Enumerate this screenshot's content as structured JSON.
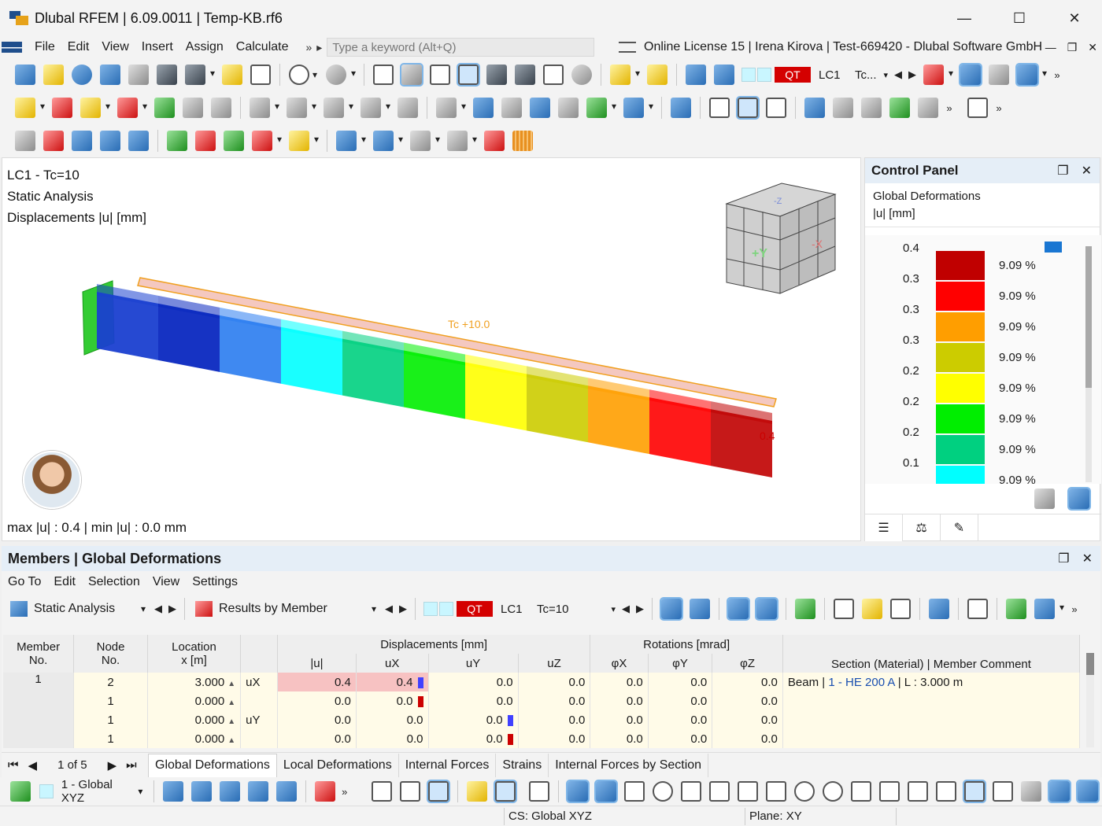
{
  "window": {
    "title": "Dlubal RFEM | 6.09.0011 | Temp-KB.rf6",
    "minimize": "—",
    "maximize": "☐",
    "close": "✕"
  },
  "menu": {
    "items": [
      "File",
      "Edit",
      "View",
      "Insert",
      "Assign",
      "Calculate"
    ],
    "more": "»",
    "search_placeholder": "Type a keyword (Alt+Q)",
    "license": "Online License 15 | Irena Kirova | Test-669420 - Dlubal Software GmbH"
  },
  "toolbar": {
    "load_case_qt": "QT",
    "load_case_name": "LC1",
    "load_case_combo": "Tc..."
  },
  "viewport": {
    "line1": "LC1 - Tc=10",
    "line2": "Static Analysis",
    "line3": "Displacements |u| [mm]",
    "load_label": "Tc +10.0",
    "max_value_label": "0.4",
    "footer": "max |u| : 0.4 | min |u| : 0.0 mm",
    "cube_face_front": "+Y",
    "cube_face_side": "-X",
    "cube_face_top": "-Z"
  },
  "control_panel": {
    "title": "Control Panel",
    "subtitle": "Global Deformations",
    "unit": "|u| [mm]",
    "legend": [
      {
        "value": "0.4",
        "percent": "9.09 %",
        "color": "#c00000"
      },
      {
        "value": "0.3",
        "percent": "9.09 %",
        "color": "#ff0000"
      },
      {
        "value": "0.3",
        "percent": "9.09 %",
        "color": "#ff9e00"
      },
      {
        "value": "0.3",
        "percent": "9.09 %",
        "color": "#cccc00"
      },
      {
        "value": "0.2",
        "percent": "9.09 %",
        "color": "#ffff00"
      },
      {
        "value": "0.2",
        "percent": "9.09 %",
        "color": "#00ee00"
      },
      {
        "value": "0.2",
        "percent": "9.09 %",
        "color": "#00d080"
      },
      {
        "value": "0.1",
        "percent": "9.09 %",
        "color": "#00ffff"
      }
    ]
  },
  "results": {
    "title": "Members | Global Deformations",
    "menu": [
      "Go To",
      "Edit",
      "Selection",
      "View",
      "Settings"
    ],
    "analysis_combo": "Static Analysis",
    "results_combo": "Results by Member",
    "lc_qt": "QT",
    "lc_name": "LC1",
    "lc_desc": "Tc=10",
    "headers": {
      "member": "Member",
      "member_sub": "No.",
      "node": "Node",
      "node_sub": "No.",
      "location": "Location",
      "location_sub": "x [m]",
      "displacements_group": "Displacements [mm]",
      "rotations_group": "Rotations [mrad]",
      "u": "|u|",
      "ux": "uX",
      "uy": "uY",
      "uz": "uZ",
      "phix": "φX",
      "phiy": "φY",
      "phiz": "φZ",
      "section": "Section (Material) | Member Comment"
    },
    "rows": [
      {
        "member": "1",
        "node": "2",
        "x": "3.000",
        "comp": "uX",
        "u": "0.4",
        "ux": "0.4",
        "uy": "0.0",
        "uz": "0.0",
        "phix": "0.0",
        "phiy": "0.0",
        "phiz": "0.0",
        "section_prefix": "Beam | ",
        "section_link": "1 - HE 200 A",
        "section_suffix": " | L : 3.000 m"
      },
      {
        "member": "",
        "node": "1",
        "x": "0.000",
        "comp": "",
        "u": "0.0",
        "ux": "0.0",
        "uy": "0.0",
        "uz": "0.0",
        "phix": "0.0",
        "phiy": "0.0",
        "phiz": "0.0",
        "section_prefix": "",
        "section_link": "",
        "section_suffix": ""
      },
      {
        "member": "",
        "node": "1",
        "x": "0.000",
        "comp": "uY",
        "u": "0.0",
        "ux": "0.0",
        "uy": "0.0",
        "uz": "0.0",
        "phix": "0.0",
        "phiy": "0.0",
        "phiz": "0.0",
        "section_prefix": "",
        "section_link": "",
        "section_suffix": ""
      },
      {
        "member": "",
        "node": "1",
        "x": "0.000",
        "comp": "",
        "u": "0.0",
        "ux": "0.0",
        "uy": "0.0",
        "uz": "0.0",
        "phix": "0.0",
        "phiy": "0.0",
        "phiz": "0.0",
        "section_prefix": "",
        "section_link": "",
        "section_suffix": ""
      }
    ],
    "pager": "1 of 5",
    "tabs": [
      "Global Deformations",
      "Local Deformations",
      "Internal Forces",
      "Strains",
      "Internal Forces by Section"
    ]
  },
  "bottom": {
    "cs_combo": "1 - Global XYZ",
    "more": "»"
  },
  "status": {
    "cs": "CS: Global XYZ",
    "plane": "Plane: XY"
  }
}
